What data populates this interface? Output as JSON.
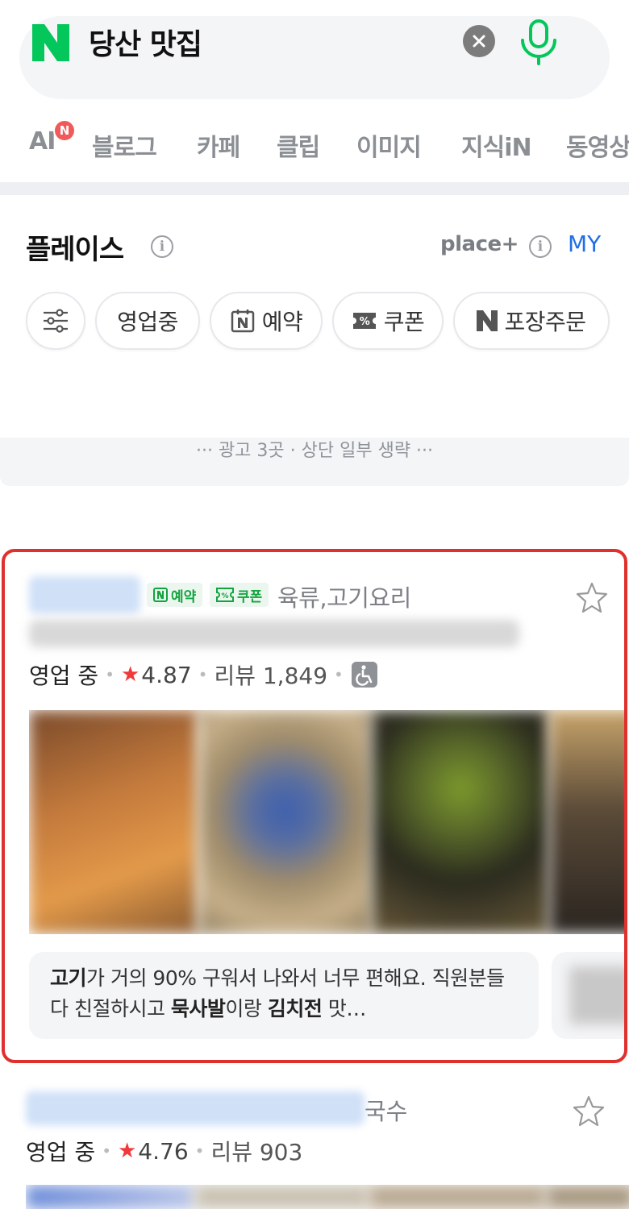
{
  "search": {
    "query": "당산 맛집",
    "clear_icon": "close-icon",
    "mic_icon": "mic-icon"
  },
  "tabs": [
    {
      "label": "AI",
      "badge": "N"
    },
    {
      "label": "블로그"
    },
    {
      "label": "카페"
    },
    {
      "label": "클립"
    },
    {
      "label": "이미지"
    },
    {
      "label": "지식iN"
    },
    {
      "label": "동영상"
    }
  ],
  "place": {
    "title": "플레이스",
    "info": "i",
    "plus": "place+",
    "my": "MY",
    "chips": [
      {
        "label": "",
        "icon": "filter-icon"
      },
      {
        "label": "영업중"
      },
      {
        "label": "예약",
        "icon": "naver-booking-icon"
      },
      {
        "label": "쿠폰",
        "icon": "coupon-icon"
      },
      {
        "label": "포장주문",
        "icon": "naver-n-icon"
      }
    ],
    "ad_notice": "··· 광고 3곳 · 상단 일부 생략 ···"
  },
  "results": [
    {
      "badges": [
        "예약",
        "쿠폰"
      ],
      "category": "육류,고기요리",
      "status": "영업 중",
      "rating": "4.87",
      "reviews": "리뷰 1,849",
      "review_snippet": {
        "parts": [
          {
            "text": "고기",
            "bold": true
          },
          {
            "text": "가 거의 90% 구워서 나와서 너무 편해요. 직원분들 다 친절하시고 ",
            "bold": false
          },
          {
            "text": "묵사발",
            "bold": true
          },
          {
            "text": "이랑 ",
            "bold": false
          },
          {
            "text": "김치전",
            "bold": true
          },
          {
            "text": " 맛…",
            "bold": false
          }
        ]
      },
      "highlight_color": "#e0302e"
    },
    {
      "category": "국수",
      "status": "영업 중",
      "rating": "4.76",
      "reviews": "리뷰 903"
    }
  ],
  "colors": {
    "naver_green": "#03c75a",
    "rating_star": "#f0393b",
    "link_blue": "#1f6fe5"
  }
}
